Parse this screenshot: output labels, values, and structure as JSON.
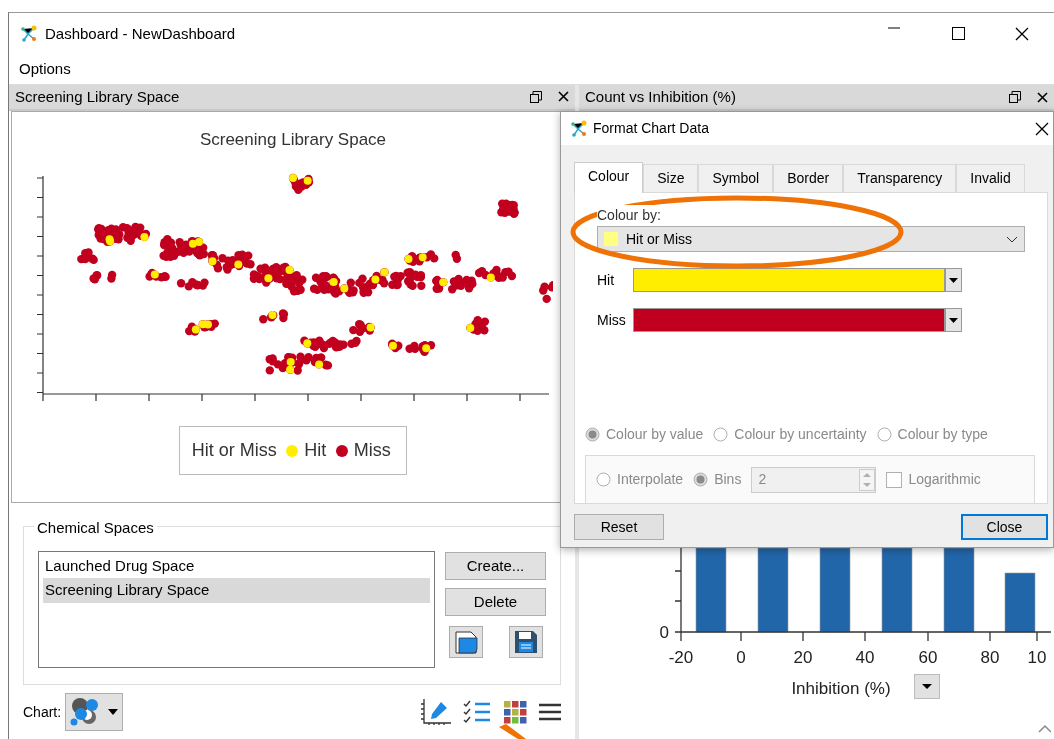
{
  "window": {
    "title": "Dashboard - NewDashboard"
  },
  "menu": [
    "Options"
  ],
  "left_panel": {
    "title": "Screening Library Space",
    "chart_title": "Screening Library Space",
    "legend": {
      "title": "Hit or Miss",
      "items": [
        {
          "label": "Hit",
          "color": "#ffee00"
        },
        {
          "label": "Miss",
          "color": "#c0001e"
        }
      ]
    },
    "chemical_spaces": {
      "title": "Chemical Spaces",
      "items": [
        {
          "label": "Launched Drug Space",
          "selected": false
        },
        {
          "label": "Screening Library Space",
          "selected": true
        }
      ],
      "buttons": [
        "Create...",
        "Delete"
      ]
    },
    "toolbar": {
      "chart_label": "Chart:"
    }
  },
  "right_panel": {
    "title": "Count vs Inhibition (%)",
    "yticks": [
      "0"
    ],
    "xticks": [
      "-20",
      "0",
      "20",
      "40",
      "60",
      "80",
      "10"
    ],
    "xlabel": "Inhibition (%)"
  },
  "dialog": {
    "title": "Format Chart Data",
    "tabs": [
      {
        "label": "Colour",
        "selected": true
      },
      {
        "label": "Size",
        "selected": false
      },
      {
        "label": "Symbol",
        "selected": false
      },
      {
        "label": "Border",
        "selected": false
      },
      {
        "label": "Transparency",
        "selected": false
      },
      {
        "label": "Invalid",
        "selected": false
      }
    ],
    "colour_by_label": "Colour by:",
    "colour_by": {
      "value": "Hit or Miss",
      "color": "#ffff80"
    },
    "mappings": [
      {
        "label": "Hit",
        "color": "#ffee00"
      },
      {
        "label": "Miss",
        "color": "#c0001e"
      }
    ],
    "options_disabled": true,
    "modes": [
      {
        "label": "Colour by value",
        "selected": true
      },
      {
        "label": "Colour by uncertainty",
        "selected": false
      },
      {
        "label": "Colour by type",
        "selected": false
      }
    ],
    "scale": [
      {
        "label": "Interpolate",
        "selected": false
      },
      {
        "label": "Bins",
        "selected": true
      }
    ],
    "bins": "2",
    "logarithmic": {
      "label": "Logarithmic",
      "checked": false
    },
    "buttons": [
      {
        "label": "Reset",
        "focused": false
      },
      {
        "label": "Close",
        "focused": true
      }
    ]
  },
  "annotations": {
    "highlight_ellipse": true,
    "pointer_arrow": true
  }
}
